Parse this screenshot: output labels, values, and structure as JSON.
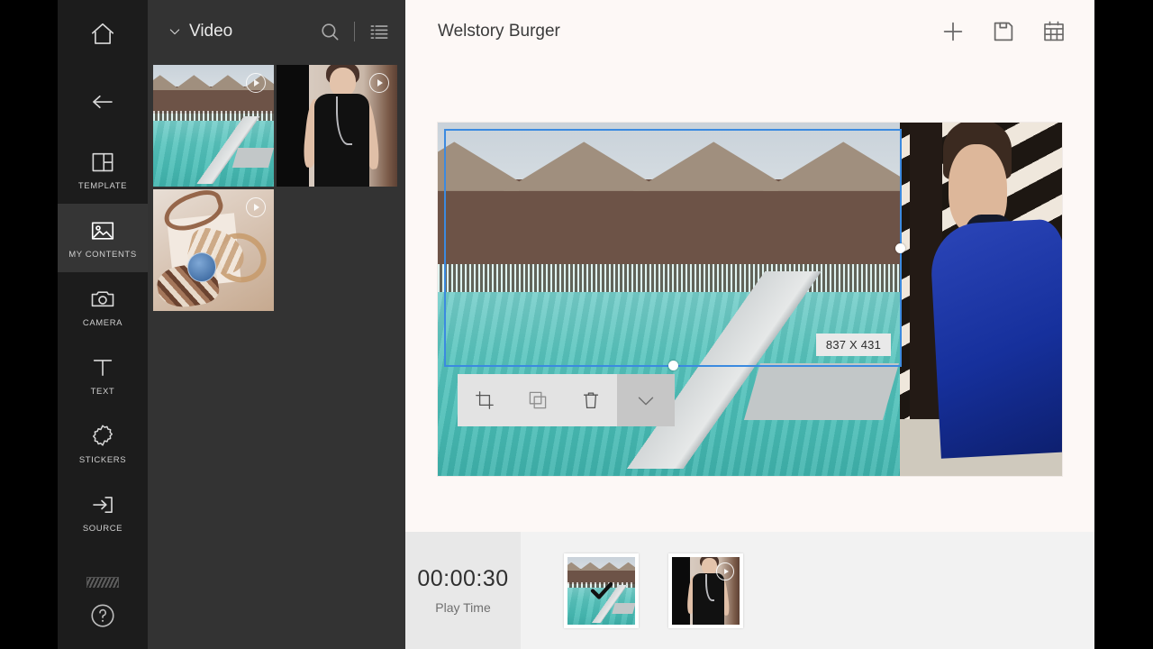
{
  "sidebar": {
    "items": [
      {
        "id": "home",
        "label": "",
        "icon": "home-icon",
        "active": false
      },
      {
        "id": "back",
        "label": "",
        "icon": "arrow-left-icon",
        "active": false
      },
      {
        "id": "template",
        "label": "TEMPLATE",
        "icon": "template-icon",
        "active": false
      },
      {
        "id": "my-contents",
        "label": "MY CONTENTS",
        "icon": "image-icon",
        "active": true
      },
      {
        "id": "camera",
        "label": "CAMERA",
        "icon": "camera-icon",
        "active": false
      },
      {
        "id": "text",
        "label": "TEXT",
        "icon": "text-icon",
        "active": false
      },
      {
        "id": "stickers",
        "label": "STICKERS",
        "icon": "sticker-icon",
        "active": false
      },
      {
        "id": "source",
        "label": "SOURCE",
        "icon": "source-icon",
        "active": false
      }
    ],
    "background_strip_icon": "background-pattern-icon",
    "help_icon": "help-circle-icon"
  },
  "browser": {
    "title": "Video",
    "collapse_icon": "chevron-down-icon",
    "search_icon": "search-icon",
    "list_icon": "list-view-icon",
    "thumbnails": [
      {
        "id": "clip-resort",
        "art": "resort",
        "has_play_badge": true
      },
      {
        "id": "clip-woman",
        "art": "woman",
        "has_play_badge": true
      },
      {
        "id": "clip-craft",
        "art": "craft",
        "has_play_badge": true
      }
    ]
  },
  "workspace": {
    "title": "Welstory Burger",
    "actions": [
      {
        "id": "add",
        "icon": "plus-icon"
      },
      {
        "id": "save",
        "icon": "save-icon"
      },
      {
        "id": "calendar",
        "icon": "calendar-icon"
      }
    ],
    "selection": {
      "size_badge": "837 X 431",
      "accent_color": "#3b8ae0",
      "handles": [
        "right-resize-handle",
        "bottom-resize-handle"
      ]
    },
    "edit_toolbar": [
      {
        "id": "crop",
        "icon": "crop-icon",
        "active": false
      },
      {
        "id": "duplicate",
        "icon": "duplicate-icon",
        "active": false
      },
      {
        "id": "delete",
        "icon": "trash-icon",
        "active": false
      },
      {
        "id": "confirm",
        "icon": "check-icon",
        "active": true
      }
    ]
  },
  "timeline": {
    "play_time_value": "00:00:30",
    "play_time_label": "Play Time",
    "clips": [
      {
        "id": "timeline-clip-1",
        "art": "resort",
        "selected": true,
        "has_play_badge": false
      },
      {
        "id": "timeline-clip-2",
        "art": "woman",
        "selected": false,
        "has_play_badge": true
      }
    ]
  },
  "colors": {
    "rail_bg": "#1c1c1c",
    "rail_active": "#353535",
    "browser_bg": "#333333",
    "stage_bg": "#fdf8f6",
    "timeline_bg": "#f2f2f2",
    "accent": "#3b8ae0",
    "letterbox": "#000000"
  }
}
